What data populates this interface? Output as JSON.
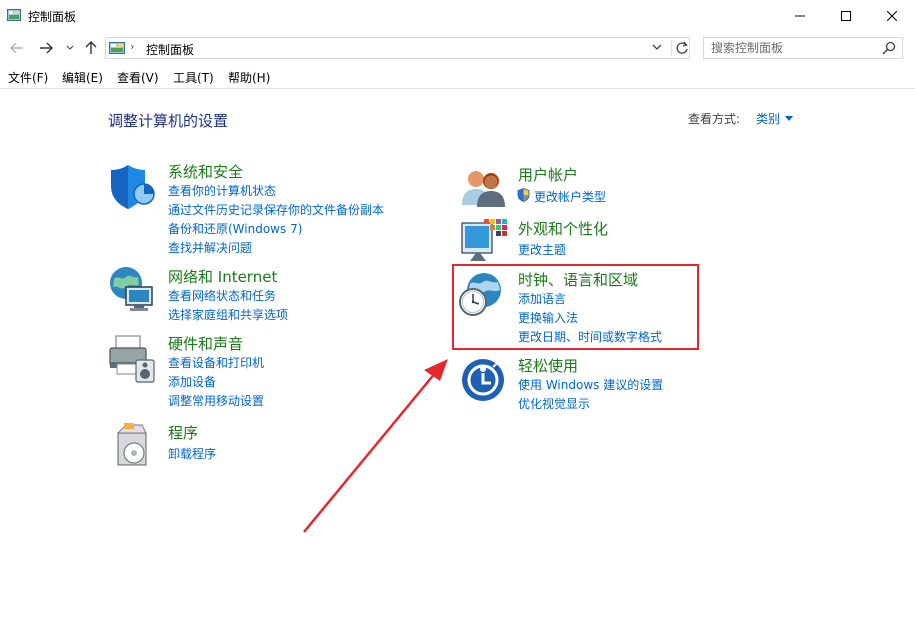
{
  "window": {
    "title": "控制面板",
    "minimize_label": "Minimize",
    "maximize_label": "Maximize",
    "close_label": "Close"
  },
  "address": {
    "path_item": "控制面板",
    "separator": "›"
  },
  "search": {
    "placeholder": "搜索控制面板"
  },
  "menu": {
    "file": "文件(F)",
    "edit": "编辑(E)",
    "view": "查看(V)",
    "tools": "工具(T)",
    "help": "帮助(H)"
  },
  "main": {
    "heading": "调整计算机的设置",
    "view_by_label": "查看方式:",
    "view_by_value": "类别"
  },
  "categories": {
    "system_security": {
      "title": "系统和安全",
      "links": [
        "查看你的计算机状态",
        "通过文件历史记录保存你的文件备份副本",
        "备份和还原(Windows 7)",
        "查找并解决问题"
      ]
    },
    "network": {
      "title": "网络和 Internet",
      "links": [
        "查看网络状态和任务",
        "选择家庭组和共享选项"
      ]
    },
    "hardware": {
      "title": "硬件和声音",
      "links": [
        "查看设备和打印机",
        "添加设备",
        "调整常用移动设置"
      ]
    },
    "programs": {
      "title": "程序",
      "links": [
        "卸载程序"
      ]
    },
    "user_accounts": {
      "title": "用户帐户",
      "links": [
        "更改帐户类型"
      ]
    },
    "appearance": {
      "title": "外观和个性化",
      "links": [
        "更改主题"
      ]
    },
    "clock_region": {
      "title": "时钟、语言和区域",
      "links": [
        "添加语言",
        "更换输入法",
        "更改日期、时间或数字格式"
      ]
    },
    "ease_access": {
      "title": "轻松使用",
      "links": [
        "使用 Windows 建议的设置",
        "优化视觉显示"
      ]
    }
  },
  "colors": {
    "category_title": "#1a7a1a",
    "link": "#0066cc",
    "heading": "#1e3287",
    "annotation": "#e3292d"
  },
  "annotation": {
    "highlight_target": "clock_region",
    "arrow": "pointing-to-clock-region"
  }
}
